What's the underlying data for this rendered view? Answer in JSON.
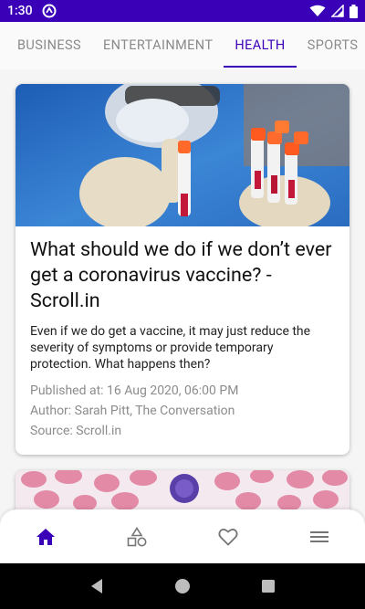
{
  "status_bar": {
    "time": "1:30"
  },
  "tabs": [
    {
      "label": "BUSINESS"
    },
    {
      "label": "ENTERTAINMENT"
    },
    {
      "label": "HEALTH",
      "active": true
    },
    {
      "label": "SPORTS"
    }
  ],
  "article": {
    "title": "What should we do if we don’t ever get a coronavirus vaccine? - Scroll.in",
    "description": "Even if we do get a vaccine, it may just reduce the severity of symptoms or provide temporary protection. What happens then?",
    "published": "Published at: 16 Aug 2020, 06:00 PM",
    "author": "Author: Sarah Pitt, The Conversation",
    "source": "Source: Scroll.in"
  },
  "bottom_nav": {
    "items": [
      {
        "icon": "home-icon",
        "active": true
      },
      {
        "icon": "categories-icon"
      },
      {
        "icon": "heart-icon"
      },
      {
        "icon": "menu-icon"
      }
    ]
  },
  "colors": {
    "accent": "#3a00b8",
    "inactive": "#8a8a8a"
  }
}
